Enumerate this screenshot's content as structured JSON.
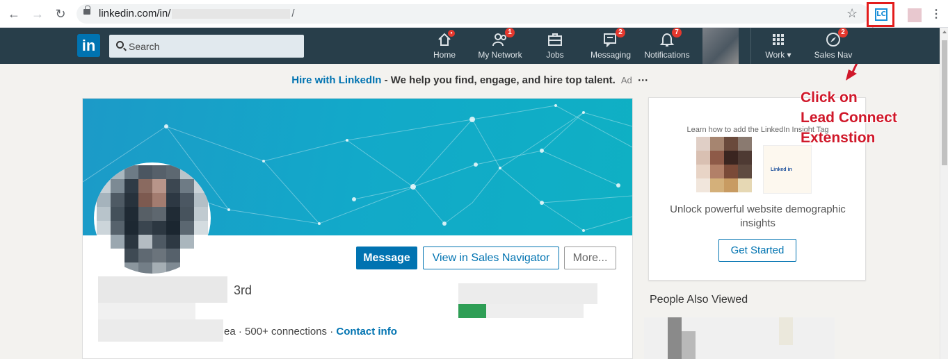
{
  "browser": {
    "url_host": "linkedin.com/in/",
    "url_tail": "/",
    "extension_label": "LC"
  },
  "nav": {
    "logo": "in",
    "search_placeholder": "Search",
    "items": [
      {
        "label": "Home",
        "badge": "•"
      },
      {
        "label": "My Network",
        "badge": "1"
      },
      {
        "label": "Jobs",
        "badge": ""
      },
      {
        "label": "Messaging",
        "badge": "2"
      },
      {
        "label": "Notifications",
        "badge": "7"
      },
      {
        "label": "Work ▾",
        "badge": ""
      },
      {
        "label": "Sales Nav",
        "badge": "2"
      }
    ]
  },
  "ad": {
    "hire": "Hire with LinkedIn",
    "separator": " - ",
    "message": "We help you find, engage, and hire top talent.",
    "ad_label": "Ad",
    "more": "⋯"
  },
  "profile": {
    "degree": "3rd",
    "location_tail": "ea",
    "connections": "500+ connections",
    "dot": "·",
    "contact_info": "Contact info",
    "message_button": "Message",
    "sales_nav_button": "View in Sales Navigator",
    "more_button": "More..."
  },
  "side_ad": {
    "small_text": "Learn how to add the LinkedIn Insight Tag",
    "logo_text": "Linked in",
    "body": "Unlock powerful website demographic insights",
    "cta": "Get Started"
  },
  "people_also_viewed": {
    "title": "People Also Viewed"
  },
  "annotation": {
    "line1": "Click on",
    "line2": "Lead Connect",
    "line3": "Extenstion"
  },
  "colors": {
    "linkedin_blue": "#0073b1",
    "nav_bg": "#283e4a",
    "badge_red": "#e5382e",
    "annotation_red": "#d0182a"
  }
}
